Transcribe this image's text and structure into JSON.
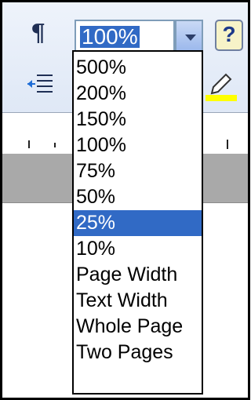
{
  "toolbar": {
    "zoom_value": "100%",
    "help_label": "?"
  },
  "zoom_dropdown": {
    "options": [
      "500%",
      "200%",
      "150%",
      "100%",
      "75%",
      "50%",
      "25%",
      "10%",
      "Page Width",
      "Text Width",
      "Whole Page",
      "Two Pages"
    ],
    "highlighted": "25%"
  },
  "colors": {
    "selection": "#316ac5",
    "highlighter": "#ffff00"
  },
  "icons": [
    "pilcrow-icon",
    "decrease-indent-icon",
    "highlight-icon",
    "dropdown-arrow-icon",
    "help-icon"
  ]
}
